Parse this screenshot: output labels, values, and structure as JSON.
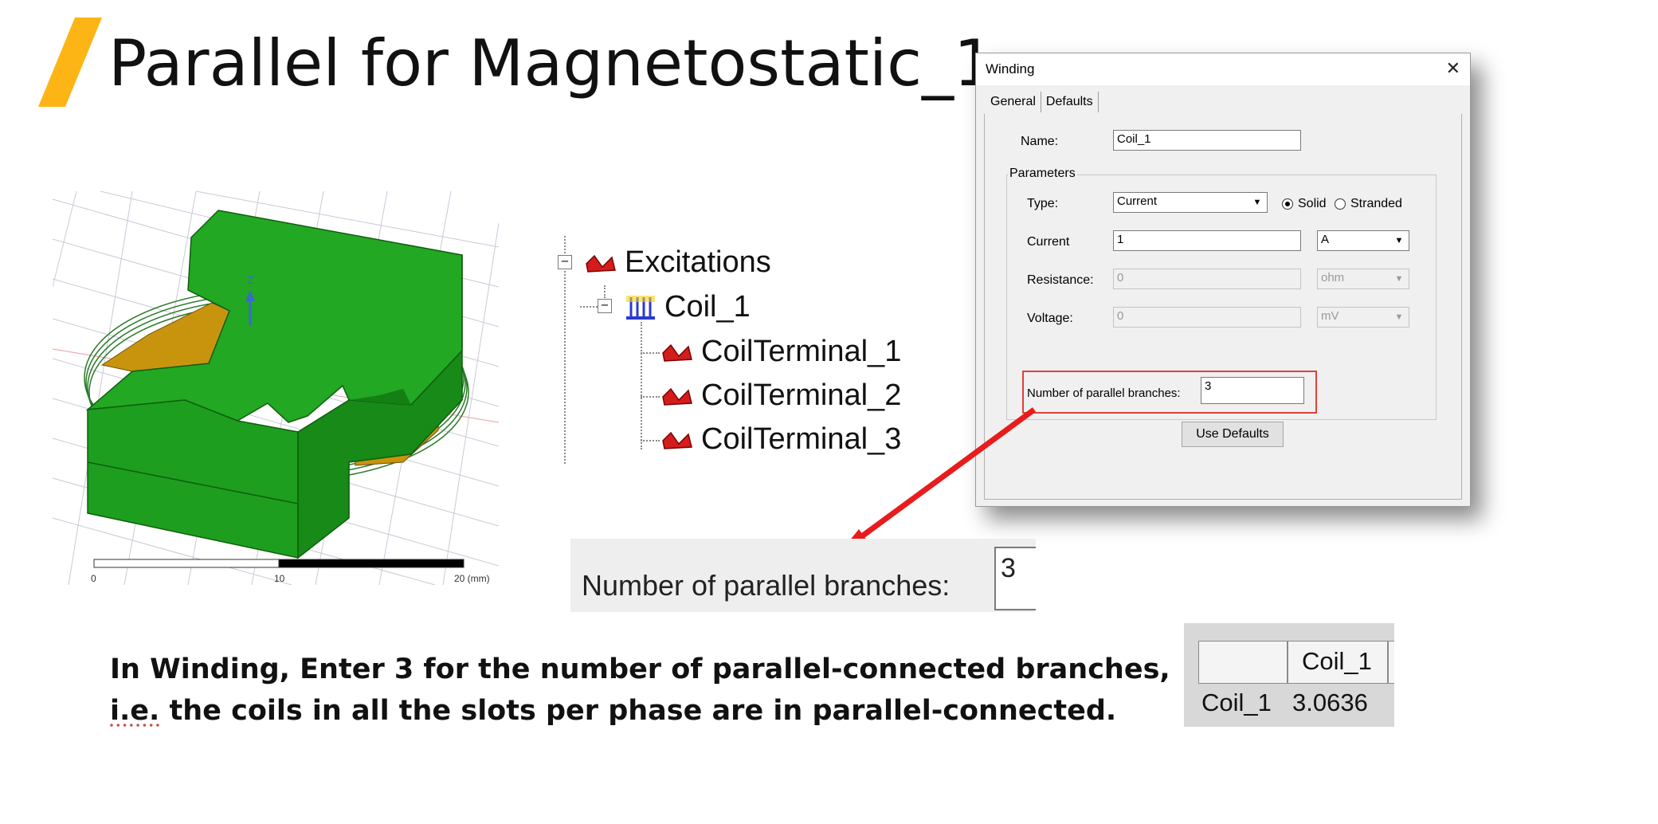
{
  "slide": {
    "title": "Parallel for Magnetostatic_1",
    "accent_color": "#FDB515",
    "body_line1": "In Winding, Enter 3 for the number of parallel-connected branches,",
    "body_line2_a": "i.e.",
    "body_line2_b": " the coils in all the slots per phase are in parallel-connected."
  },
  "model": {
    "axis_label": "Z",
    "scale_labels": [
      "0",
      "10",
      "20 (mm)"
    ],
    "body_color": "#1E9E1E",
    "coil_color": "#C8940E"
  },
  "tree": {
    "root": "Excitations",
    "coil": "Coil_1",
    "terminals": [
      "CoilTerminal_1",
      "CoilTerminal_2",
      "CoilTerminal_3"
    ],
    "expander_symbol": "−"
  },
  "dialog": {
    "title": "Winding",
    "close_glyph": "✕",
    "tabs": [
      "General",
      "Defaults"
    ],
    "name_label": "Name:",
    "name_value": "Coil_1",
    "parameters_label": "Parameters",
    "type_label": "Type:",
    "type_value": "Current",
    "radio_solid": "Solid",
    "radio_stranded": "Stranded",
    "current_label": "Current",
    "current_value": "1",
    "current_unit": "A",
    "resistance_label": "Resistance:",
    "resistance_value": "0",
    "resistance_unit": "ohm",
    "voltage_label": "Voltage:",
    "voltage_value": "0",
    "voltage_unit": "mV",
    "branches_label": "Number of parallel branches:",
    "branches_value": "3",
    "use_defaults": "Use Defaults",
    "dropdown_glyph": "▼",
    "highlight_color": "#E0403A"
  },
  "zoom": {
    "label": "Number of parallel branches:",
    "value": "3"
  },
  "result": {
    "column_header": "Coil_1",
    "row_header": "Coil_1",
    "value": "3.0636"
  }
}
